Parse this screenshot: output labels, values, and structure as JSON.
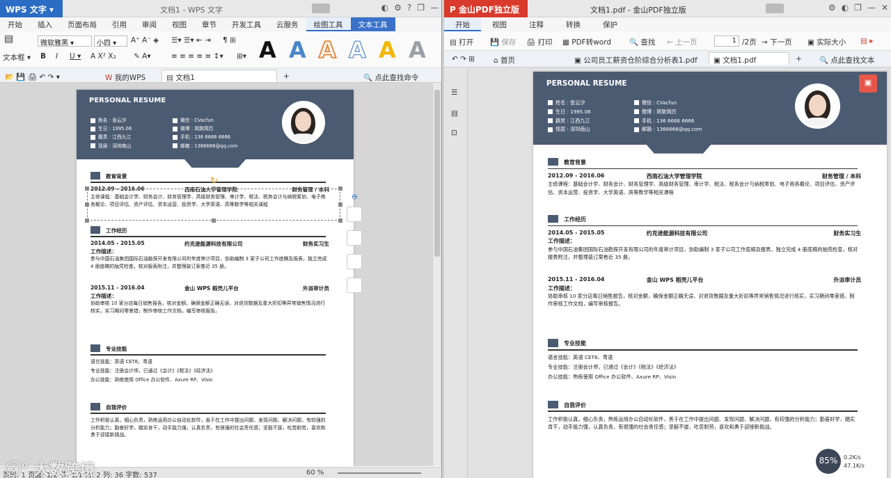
{
  "wps": {
    "app_button": "WPS 文字",
    "title": "文档1 - WPS 文字",
    "menus": [
      "开始",
      "插入",
      "页面布局",
      "引用",
      "审阅",
      "视图",
      "章节",
      "开发工具",
      "云服务",
      "绘图工具",
      "文本工具"
    ],
    "font_name": "微软雅黑",
    "font_size": "小四",
    "textbox_label": "文本框",
    "tabs": [
      "我的WPS",
      "文档1"
    ],
    "search_hint": "点此查找命令",
    "status": "页码: 1   页面: 1/2   节: 1/1   行: 2   列: 36   字数: 537",
    "zoom": "60 %",
    "wordart_colors": [
      "#111111",
      "#4a86c9",
      "#e8883c",
      "#6f9ccf",
      "#f2b705",
      "#9aa0a6"
    ]
  },
  "pdf": {
    "app_button": "金山PDF独立版",
    "title": "文档1.pdf - 金山PDF独立版",
    "menus": [
      "开始",
      "视图",
      "注释",
      "转换",
      "保护"
    ],
    "tools": {
      "open": "打开",
      "save": "保存",
      "print": "打印",
      "to_word": "PDF转word",
      "find": "查找",
      "prev": "上一页",
      "page_value": "1",
      "page_total": "/2页",
      "next": "下一页",
      "actual_size": "实际大小"
    },
    "tabs": [
      "首页",
      "公司员工薪资仓阶综合分析表1.pdf",
      "文档1.pdf"
    ],
    "search_hint": "点此查找文本",
    "speed_percent": "85%",
    "speed_up": "0.2K/s",
    "speed_down": "47.1K/s"
  },
  "watermark": "大数跨境",
  "resume": {
    "title": "PERSONAL RESUME",
    "info_left": [
      "姓名 :  张云汐",
      "生日 :  1995.06",
      "籍贯 :  江西九江",
      "现居 :  深圳南山"
    ],
    "info_right": [
      "微信 :  CVacfun",
      "微博 :  简致简历",
      "手机 :  136 6666 6666",
      "邮箱 :  1366666@qq.com"
    ],
    "sections": {
      "edu": "教育背景",
      "work": "工作经历",
      "skills": "专业技能",
      "self": "自我评价"
    },
    "edu": {
      "date": "2012.09 - 2016.06",
      "school": "西南石油大学管理学院",
      "major": "财务管理 / 本科",
      "courses": "主修课程：基础会计学、财务会计、财务管理学、高级财务管理、审计学、税法、税务会计与纳税筹划、电子商务概论、项目评估、资产评估、资本运营、投资学、大学英语、高等数学等相关课程"
    },
    "job1": {
      "date": "2014.05 - 2015.05",
      "company": "约克逊能源科技有限公司",
      "role": "财务实习生",
      "label": "工作描述：",
      "desc": "参与中国石油集团国际石油勘探开发有限公司的年度审计项目，协助编制 3 家子公司工作底稿及报表，独立完成 4 册底稿的抽凭检查，核对报表附注，并整理装订案卷近 35 册。"
    },
    "job2": {
      "date": "2015.11 - 2016.04",
      "company": "金山 WPS 稻壳儿平台",
      "role": "外派审计员",
      "label": "工作描述：",
      "desc": "协助审核 10 家分店每日销售报告，核对金额，确保金额正确无误，对退货数据及重大折扣等异常销售情况进行核实，实习期间零差错，制作审核工作文档，编写审核报告。"
    },
    "skills": [
      "语言技能：英语 CET6、粤语",
      "专业技能：注册会计师，已通过《会计》《税法》《经济法》",
      "办公技能：熟练使用 Office 办公软件、Axure RP、Visio"
    ],
    "self_eval": "工作积极认真，细心负责，熟练运用办公自动化软件，善于在工作中提出问题、发现问题、解决问题，有较强的分析能力；勤奋好学，踏实肯干，动手能力强，认真负责，有很强的社会责任感；坚毅不拔，吃苦耐劳，喜欢和勇于迎接新挑战。"
  }
}
